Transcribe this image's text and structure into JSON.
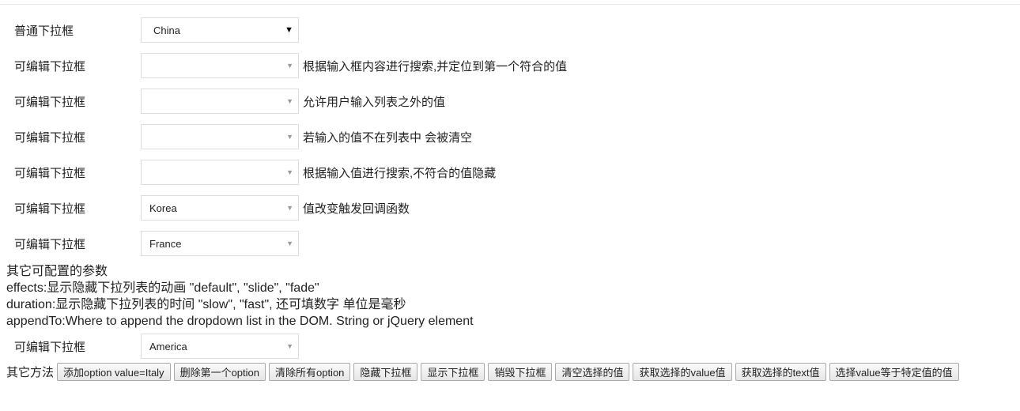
{
  "rows": [
    {
      "label": "普通下拉框",
      "value": "China",
      "native": true,
      "desc": ""
    },
    {
      "label": "可编辑下拉框",
      "value": "",
      "desc": "根据输入框内容进行搜索,并定位到第一个符合的值"
    },
    {
      "label": "可编辑下拉框",
      "value": "",
      "desc": "允许用户输入列表之外的值"
    },
    {
      "label": "可编辑下拉框",
      "value": "",
      "desc": "若输入的值不在列表中 会被清空"
    },
    {
      "label": "可编辑下拉框",
      "value": "",
      "desc": "根据输入值进行搜索,不符合的值隐藏"
    },
    {
      "label": "可编辑下拉框",
      "value": "Korea",
      "desc": "值改变触发回调函数"
    },
    {
      "label": "可编辑下拉框",
      "value": "France",
      "desc": ""
    }
  ],
  "params": {
    "title": "其它可配置的参数",
    "lines": [
      "effects:显示隐藏下拉列表的动画 \"default\", \"slide\", \"fade\"",
      "duration:显示隐藏下拉列表的时间 \"slow\", \"fast\", 还可填数字 单位是毫秒",
      "appendTo:Where to append the dropdown list in the DOM. String or jQuery element"
    ]
  },
  "last_row": {
    "label": "可编辑下拉框",
    "value": "America"
  },
  "methods": {
    "label": "其它方法",
    "buttons": [
      "添加option value=Italy",
      "删除第一个option",
      "清除所有option",
      "隐藏下拉框",
      "显示下拉框",
      "销毁下拉框",
      "清空选择的值",
      "获取选择的value值",
      "获取选择的text值",
      "选择value等于特定值的值"
    ]
  }
}
